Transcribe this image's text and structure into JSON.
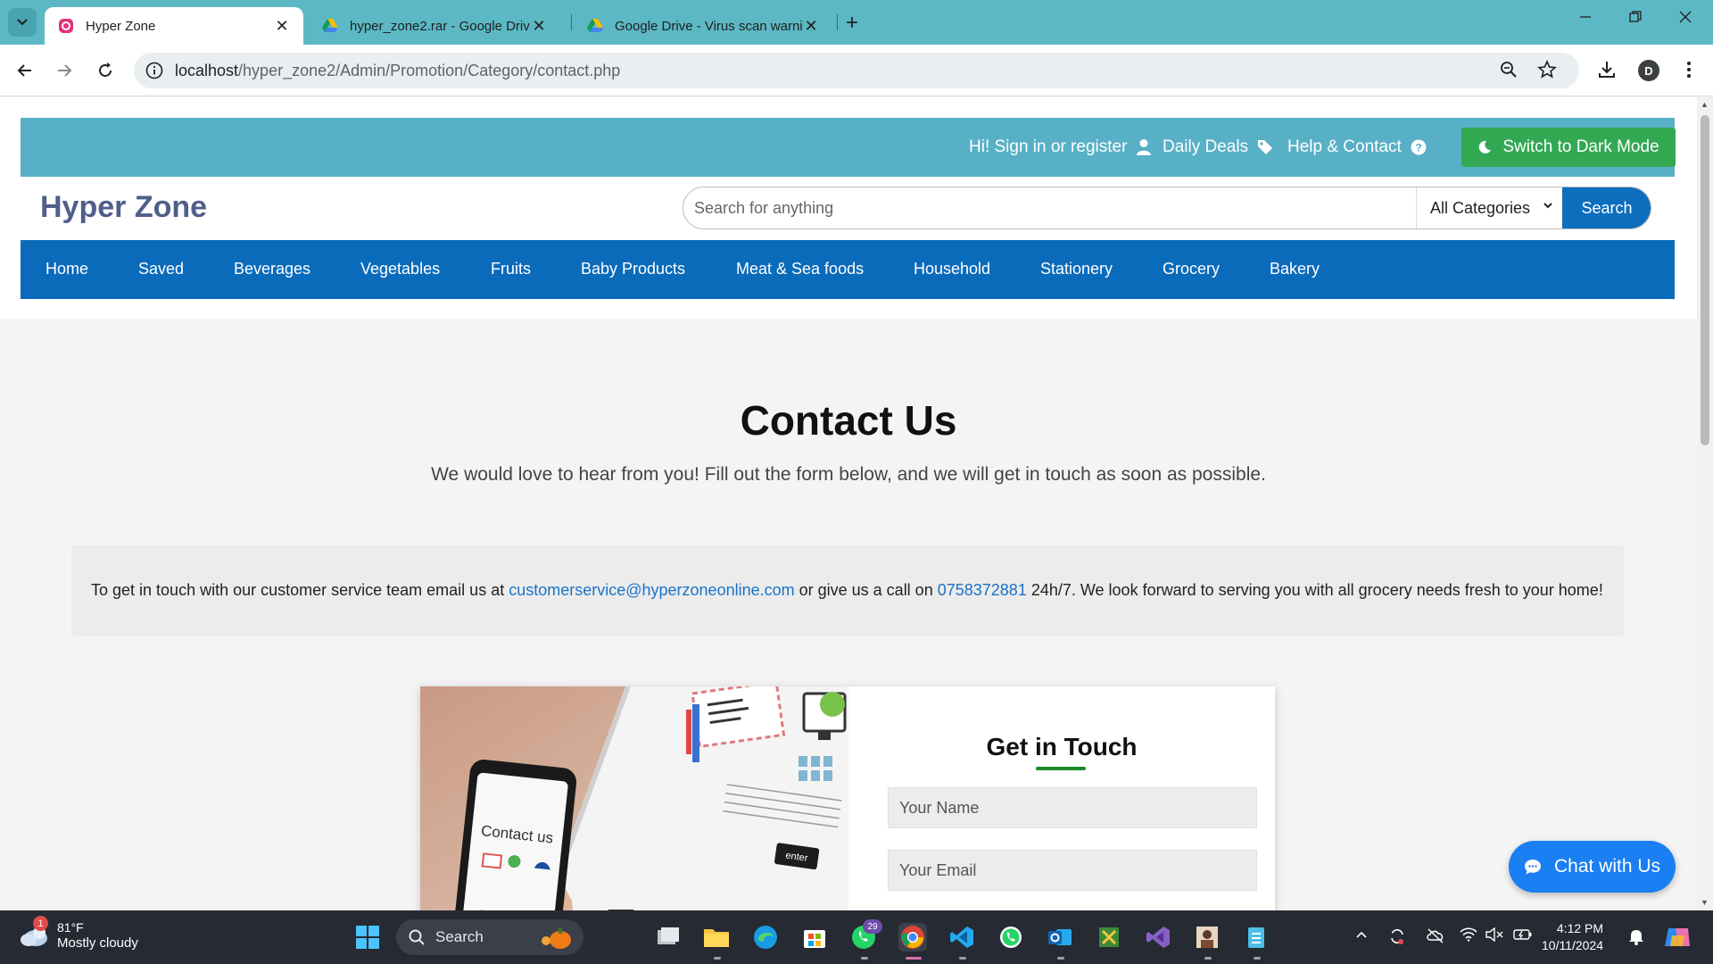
{
  "browser": {
    "tabs": [
      {
        "title": "Hyper Zone",
        "active": true,
        "icon": "hyperzone-favicon-icon"
      },
      {
        "title": "hyper_zone2.rar - Google Drive",
        "active": false,
        "icon": "google-drive-icon"
      },
      {
        "title": "Google Drive - Virus scan warni",
        "active": false,
        "icon": "google-drive-icon"
      }
    ],
    "url_host": "localhost",
    "url_path": "/hyper_zone2/Admin/Promotion/Category/contact.php",
    "profile_initial": "D"
  },
  "header": {
    "signin": "Hi! Sign in or register",
    "daily_deals": "Daily Deals",
    "help_contact": "Help & Contact",
    "dark_mode": "Switch to Dark Mode",
    "brand": "Hyper Zone",
    "search_placeholder": "Search for anything",
    "category_selected": "All Categories",
    "search_button": "Search",
    "topbar_color": "#58b0c6",
    "nav_color": "#0a6bbb",
    "dark_button_color": "#33a853"
  },
  "nav": {
    "items": [
      "Home",
      "Saved",
      "Beverages",
      "Vegetables",
      "Fruits",
      "Baby Products",
      "Meat & Sea foods",
      "Household",
      "Stationery",
      "Grocery",
      "Bakery"
    ]
  },
  "contact": {
    "title": "Contact Us",
    "subtitle": "We would love to hear from you! Fill out the form below, and we will get in touch as soon as possible.",
    "info_prefix": "To get in touch with our customer service team email us at ",
    "email": "customerservice@hyperzoneonline.com",
    "info_middle": " or give us a call on ",
    "phone": "0758372881",
    "info_suffix": " 24h/7. We look forward to serving you with all grocery needs fresh to your home!",
    "image_caption": "Contact us",
    "image_key_label": "enter",
    "form_title": "Get in Touch",
    "name_placeholder": "Your Name",
    "email_placeholder": "Your Email",
    "chat_button": "Chat with Us"
  },
  "taskbar": {
    "weather_temp": "81°F",
    "weather_desc": "Mostly cloudy",
    "weather_badge": "1",
    "search_label": "Search",
    "whatsapp_badge": "29",
    "time": "4:12 PM",
    "date": "10/11/2024"
  }
}
